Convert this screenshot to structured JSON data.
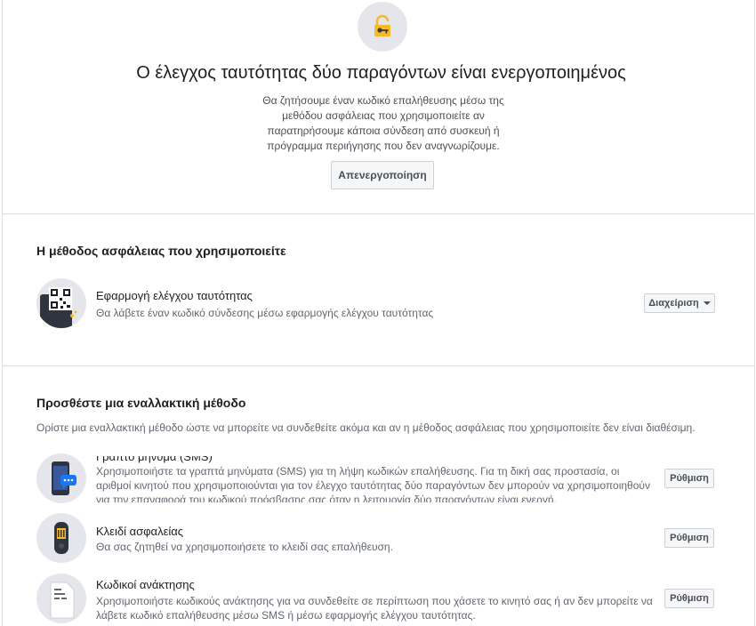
{
  "header": {
    "title": "Ο έλεγχος ταυτότητας δύο παραγόντων είναι ενεργοποιημένος",
    "description": "Θα ζητήσουμε έναν κωδικό επαλήθευσης μέσω της μεθόδου ασφάλειας που χρησιμοποιείτε αν παρατηρήσουμε κάποια σύνδεση από συσκευή ή πρόγραμμα περιήγησης που δεν αναγνωρίζουμε.",
    "disable_button": "Απενεργοποίηση",
    "icon": "unlocked-padlock-with-key-icon"
  },
  "current_method": {
    "section_title": "Η μέθοδος ασφάλειας που χρησιμοποιείτε",
    "title": "Εφαρμογή ελέγχου ταυτότητας",
    "description": "Θα λάβετε έναν κωδικό σύνδεσης μέσω εφαρμογής ελέγχου ταυτότητας",
    "manage_button": "Διαχείριση",
    "icon": "qr-code-phone-icon"
  },
  "alternatives": {
    "section_title": "Προσθέστε μια εναλλακτική μέθοδο",
    "intro": "Ορίστε μια εναλλακτική μέθοδο ώστε να μπορείτε να συνδεθείτε ακόμα και αν η μέθοδος ασφάλειας που χρησιμοποιείτε δεν είναι διαθέσιμη.",
    "items": [
      {
        "title": "Γραπτό μήνυμα (SMS)",
        "description": "Χρησιμοποιήστε τα γραπτά μηνύματα (SMS) για τη λήψη κωδικών επαλήθευσης. Για τη δική σας προστασία, οι αριθμοί κινητού που χρησιμοποιούνται για τον έλεγχο ταυτότητας δύο παραγόντων δεν μπορούν να χρησιμοποιηθούν για την επαναφορά του κωδικού πρόσβασης σας όταν η λειτουργία δύο παραγόντων είναι ενεργή.",
        "button": "Ρύθμιση",
        "icon": "phone-message-icon"
      },
      {
        "title": "Κλειδί ασφαλείας",
        "description": "Θα σας ζητηθεί να χρησιμοποιήσετε το κλειδί σας επαλήθευση.",
        "button": "Ρύθμιση",
        "icon": "usb-security-key-icon"
      },
      {
        "title": "Κωδικοί ανάκτησης",
        "description": "Χρησιμοποιήστε κωδικούς ανάκτησης για να συνδεθείτε σε περίπτωση που χάσετε το κινητό σας ή αν δεν μπορείτε να λάβετε κωδικό επαλήθευσης μέσω SMS ή μέσω εφαρμογής ελέγχου ταυτότητας.",
        "button": "Ρύθμιση",
        "icon": "recovery-codes-document-icon"
      }
    ]
  },
  "colors": {
    "accent_yellow": "#f7b928",
    "circle_gray": "#e4e6eb",
    "messenger_blue": "#1877f2"
  }
}
